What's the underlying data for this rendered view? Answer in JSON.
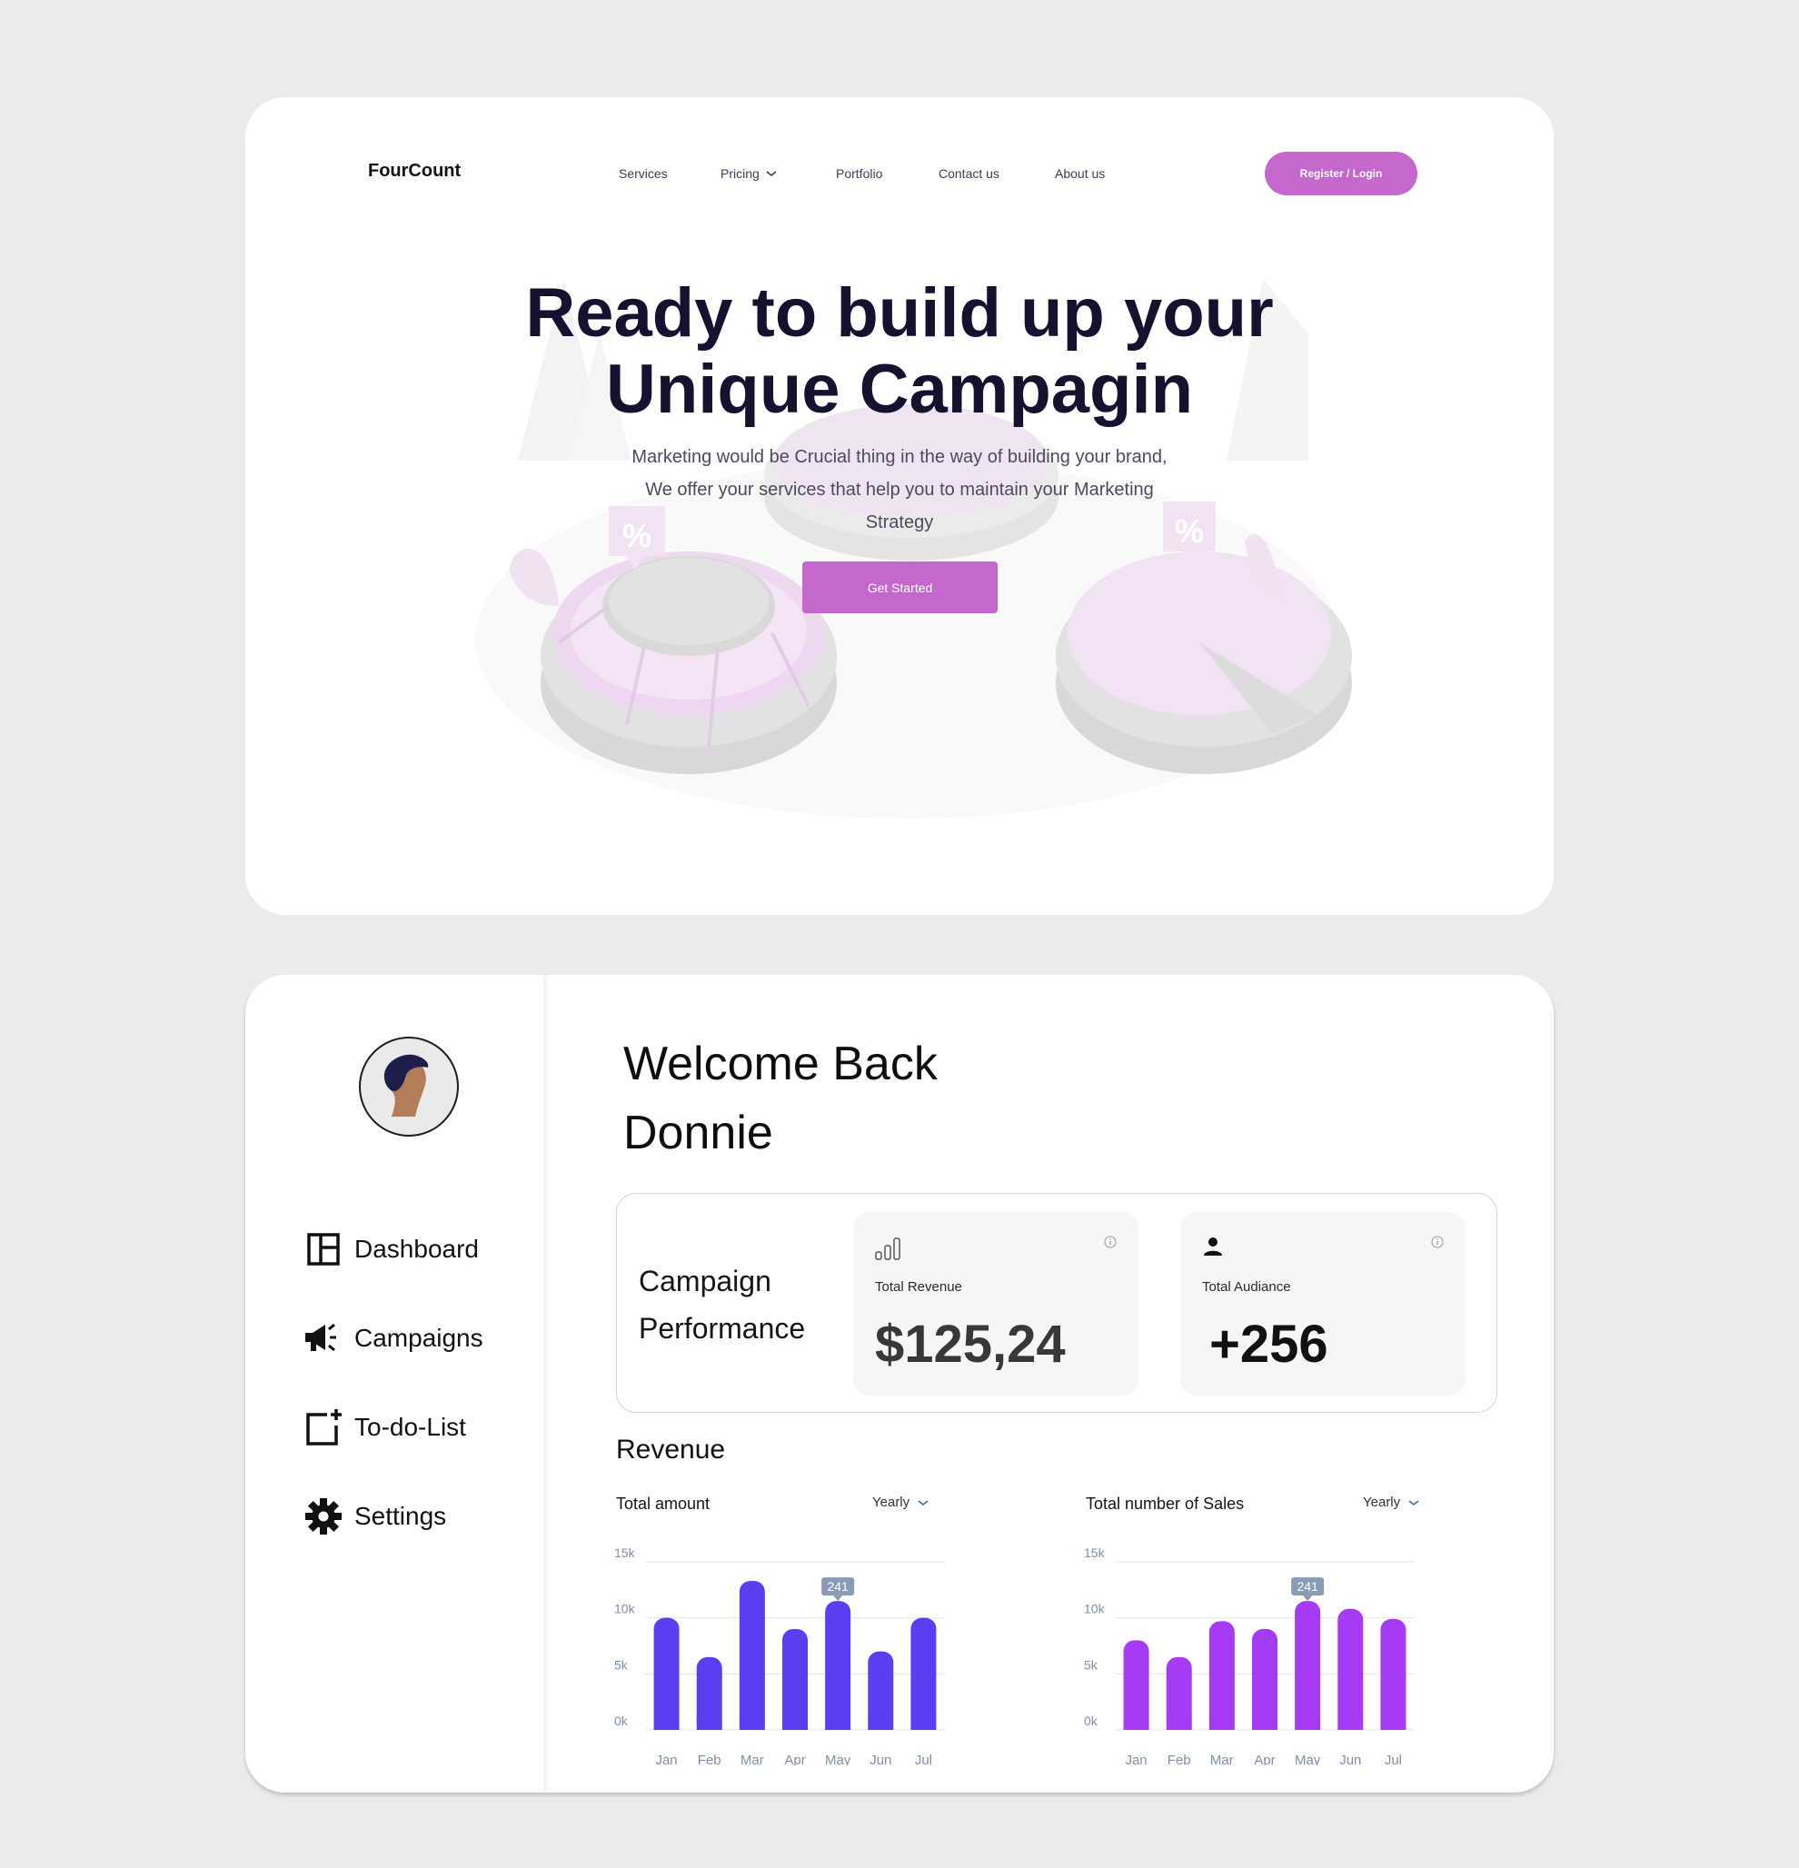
{
  "landing": {
    "logo": "FourCount",
    "nav": {
      "services": "Services",
      "pricing": "Pricing",
      "portfolio": "Portfolio",
      "contact": "Contact us",
      "about": "About us"
    },
    "register_label": "Register / Login",
    "hero_title_line1": "Ready to build up your",
    "hero_title_line2": "Unique Campagin",
    "hero_sub_line1": "Marketing would be Crucial thing in the way of building your brand,",
    "hero_sub_line2": "We offer your services that help you to maintain your Marketing",
    "hero_sub_line3": "Strategy",
    "cta_label": "Get Started",
    "illustration_badge": "%"
  },
  "dashboard": {
    "sidebar": {
      "items": [
        {
          "label": "Dashboard",
          "icon": "dashboard-icon"
        },
        {
          "label": "Campaigns",
          "icon": "megaphone-icon"
        },
        {
          "label": "To-do-List",
          "icon": "add-note-icon"
        },
        {
          "label": "Settings",
          "icon": "gear-icon"
        }
      ]
    },
    "welcome_line1": "Welcome Back",
    "welcome_line2": "Donnie",
    "performance": {
      "title_line1": "Campaign",
      "title_line2": "Performance",
      "revenue_label": "Total Revenue",
      "revenue_value": "$125,24",
      "audience_label": "Total Audiance",
      "audience_value": "+256"
    },
    "revenue_title": "Revenue",
    "select_label": "Yearly"
  },
  "colors": {
    "accent": "#c468cd",
    "bar_blue": "#5b3ef0",
    "bar_purple": "#a53bf5",
    "tooltip": "#8a9bb5"
  },
  "chart_data": [
    {
      "type": "bar",
      "title": "Total amount",
      "categories": [
        "Jan",
        "Feb",
        "Mar",
        "Apr",
        "May",
        "Jun",
        "Jul"
      ],
      "values": [
        10000,
        6500,
        13300,
        9000,
        11500,
        7000,
        10000
      ],
      "y_ticks": [
        "0k",
        "5k",
        "10k",
        "15k"
      ],
      "ylim": [
        0,
        15000
      ],
      "tooltip": {
        "category": "May",
        "label": "241"
      },
      "grid": true
    },
    {
      "type": "bar",
      "title": "Total number of Sales",
      "categories": [
        "Jan",
        "Feb",
        "Mar",
        "Apr",
        "May",
        "Jun",
        "Jul"
      ],
      "values": [
        8000,
        6500,
        9700,
        9000,
        11500,
        10800,
        9900
      ],
      "y_ticks": [
        "0k",
        "5k",
        "10k",
        "15k"
      ],
      "ylim": [
        0,
        15000
      ],
      "tooltip": {
        "category": "May",
        "label": "241"
      },
      "grid": true
    }
  ]
}
